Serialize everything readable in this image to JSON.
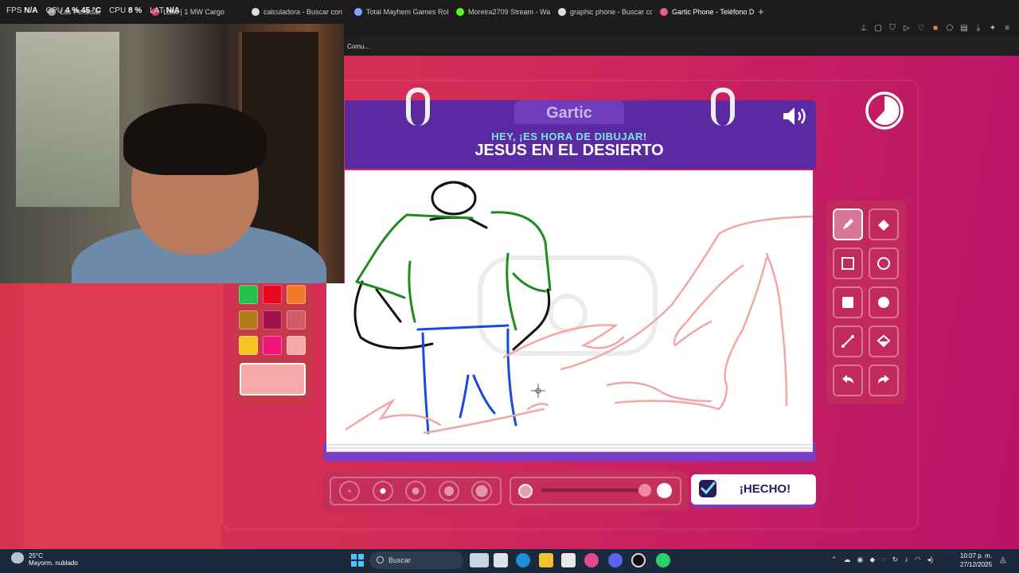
{
  "overlay": {
    "fps_label": "FPS",
    "fps_value": "N/A",
    "gpu_label": "GPU",
    "gpu_value": "4 % 45 °C",
    "cpu_label": "CPU",
    "cpu_value": "8 %",
    "lat_label": "LAT",
    "lat_value": "N/A"
  },
  "tabs": [
    {
      "label": "Las Perdidas",
      "color": "#9aa0a6"
    },
    {
      "label": "Lolla | 1 MW Cargo",
      "color": "#d93b7a"
    },
    {
      "label": "calculadora - Buscar con",
      "color": "#dddddd"
    },
    {
      "label": "Total Mayhem Games Roll",
      "color": "#7fa6ff"
    },
    {
      "label": "Moreira2709 Stream - Wa",
      "color": "#53fc18"
    },
    {
      "label": "graphic phone - Buscar co",
      "color": "#dddddd"
    },
    {
      "label": "Gartic Phone - Teléfono D",
      "color": "#e85a9a",
      "active": true
    }
  ],
  "new_tab": "+",
  "bookmark": "Comu...",
  "game": {
    "logo": "Gartic",
    "subtitle": "HEY, ¡ES HORA DE DIBUJAR!",
    "title": "JESUS EN EL DESIERTO",
    "done_label": "¡HECHO!",
    "watermark": "Gartic PHONE"
  },
  "palette": {
    "colors": [
      "#22c14a",
      "#e8091f",
      "#f47a2a",
      "#b57b1a",
      "#a0104a",
      "#cf5b6a",
      "#fbc521",
      "#f0137c",
      "#f8a8a8"
    ],
    "selected": "#f8a8a8"
  },
  "tools": [
    "pencil-icon",
    "eraser-icon",
    "square-outline-icon",
    "circle-outline-icon",
    "square-filled-icon",
    "circle-filled-icon",
    "line-icon",
    "fill-bucket-icon",
    "undo-icon",
    "redo-icon"
  ],
  "brush_sizes": {
    "count": 5,
    "selected_index": 1
  },
  "opacity": {
    "value": 1.0
  },
  "taskbar": {
    "temp": "25°C",
    "weather": "Mayorm. nublado",
    "search_placeholder": "Buscar",
    "time": "10:07 p. m.",
    "date": "27/12/2025"
  }
}
